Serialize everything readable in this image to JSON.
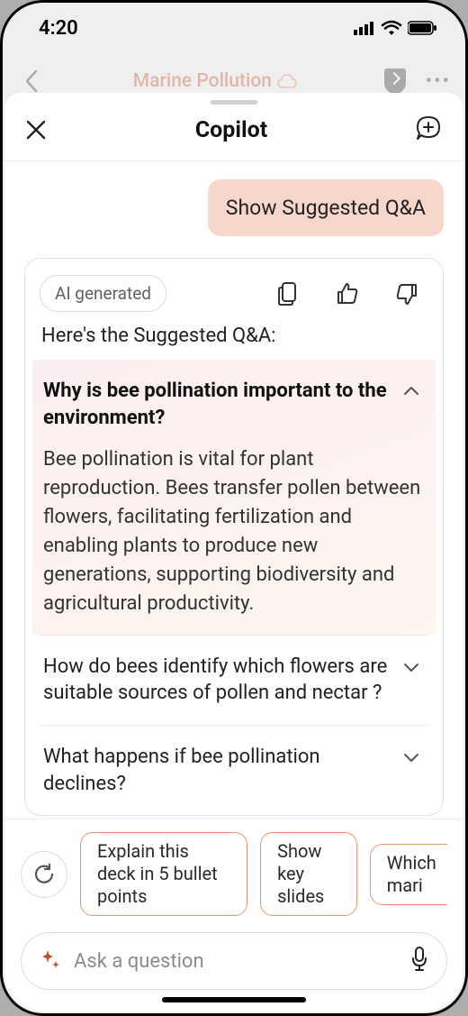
{
  "status": {
    "time": "4:20"
  },
  "background_app": {
    "title": "Marine Pollution"
  },
  "sheet": {
    "title": "Copilot",
    "user_message": "Show Suggested Q&A",
    "ai_badge": "AI generated",
    "reply_intro": "Here's the Suggested Q&A:",
    "qa": [
      {
        "question": "Why is bee pollination important to the environment?",
        "answer": "Bee pollination is vital for plant reproduction. Bees transfer pollen between flowers, facilitating fertilization and enabling plants to produce new generations, supporting biodiversity and agricultural productivity.",
        "expanded": true
      },
      {
        "question": "How do bees identify which flowers are suitable sources of pollen and nectar ?",
        "answer": "",
        "expanded": false
      },
      {
        "question": "What happens if bee pollination declines?",
        "answer": "",
        "expanded": false
      }
    ],
    "chips": [
      "Explain this deck in 5 bullet points",
      "Show key slides",
      "Which mari"
    ],
    "ask_placeholder": "Ask a question"
  }
}
